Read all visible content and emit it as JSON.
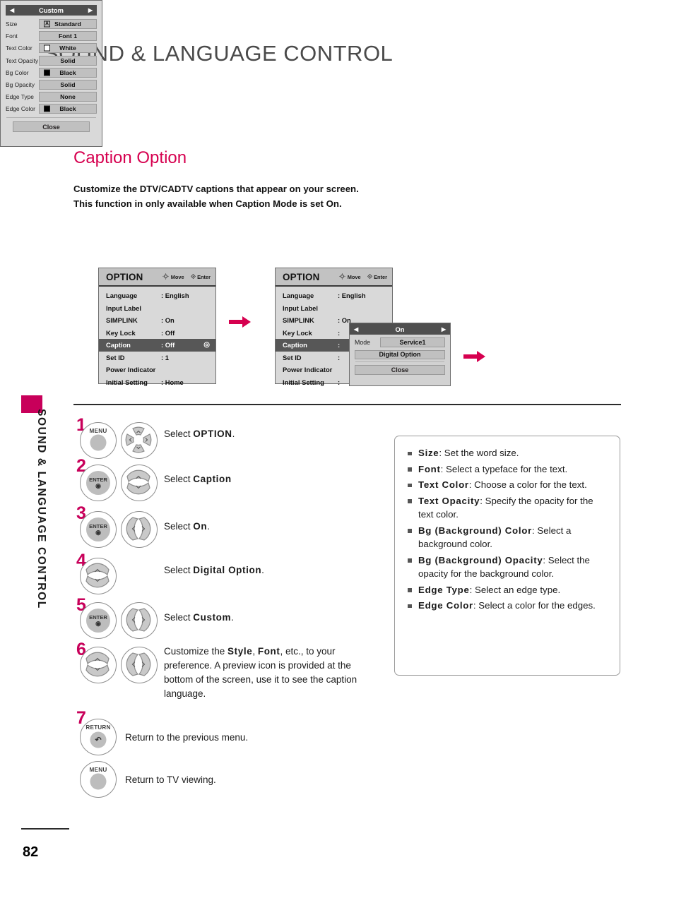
{
  "page": {
    "header_title": "SOUND & LANGUAGE CONTROL",
    "side_label": "SOUND & LANGUAGE CONTROL",
    "number": "82",
    "accent_color": "#c8005a"
  },
  "section": {
    "title": "Caption Option",
    "intro_line1": "Customize the DTV/CADTV captions that appear on your screen.",
    "intro_line2_a": "This function in only available when ",
    "intro_line2_b": "Caption",
    "intro_line2_c": " Mode is set ",
    "intro_line2_d": "On",
    "intro_line2_e": "."
  },
  "osd": {
    "menu1": {
      "title": "OPTION",
      "hint_move": "Move",
      "hint_enter": "Enter",
      "rows": [
        {
          "label": "Language",
          "value": ": English",
          "selected": false
        },
        {
          "label": "Input Label",
          "value": "",
          "selected": false
        },
        {
          "label": "SIMPLINK",
          "value": ": On",
          "selected": false
        },
        {
          "label": "Key Lock",
          "value": ": Off",
          "selected": false
        },
        {
          "label": "Caption",
          "value": ": Off",
          "selected": true
        },
        {
          "label": "Set ID",
          "value": ": 1",
          "selected": false
        },
        {
          "label": "Power Indicator",
          "value": "",
          "selected": false
        },
        {
          "label": "Initial Setting",
          "value": ": Home",
          "selected": false
        }
      ]
    },
    "menu2": {
      "title": "OPTION",
      "hint_move": "Move",
      "hint_enter": "Enter",
      "rows": [
        {
          "label": "Language",
          "value": ": English",
          "selected": false
        },
        {
          "label": "Input Label",
          "value": "",
          "selected": false
        },
        {
          "label": "SIMPLINK",
          "value": ": On",
          "selected": false
        },
        {
          "label": "Key Lock",
          "value": ":",
          "selected": false
        },
        {
          "label": "Caption",
          "value": ":",
          "selected": true
        },
        {
          "label": "Set ID",
          "value": ":",
          "selected": false
        },
        {
          "label": "Power Indicator",
          "value": "",
          "selected": false
        },
        {
          "label": "Initial Setting",
          "value": ":",
          "selected": false
        }
      ]
    },
    "popup": {
      "bar_title": "On",
      "left_arrow": "◀",
      "right_arrow": "▶",
      "mode_label": "Mode",
      "mode_value": "Service1",
      "digital_option": "Digital Option",
      "close": "Close"
    },
    "custom": {
      "bar_title": "Custom",
      "left_arrow": "◀",
      "right_arrow": "▶",
      "rows": [
        {
          "label": "Size",
          "value": "Standard",
          "swatch": "letter",
          "swatch_text": "A",
          "swatch_color": ""
        },
        {
          "label": "Font",
          "value": "Font 1",
          "swatch": "none",
          "swatch_text": "",
          "swatch_color": ""
        },
        {
          "label": "Text Color",
          "value": "White",
          "swatch": "color",
          "swatch_text": "",
          "swatch_color": "#ffffff"
        },
        {
          "label": "Text Opacity",
          "value": "Solid",
          "swatch": "none",
          "swatch_text": "",
          "swatch_color": ""
        },
        {
          "label": "Bg Color",
          "value": "Black",
          "swatch": "color",
          "swatch_text": "",
          "swatch_color": "#000000"
        },
        {
          "label": "Bg Opacity",
          "value": "Solid",
          "swatch": "none",
          "swatch_text": "",
          "swatch_color": ""
        },
        {
          "label": "Edge Type",
          "value": "None",
          "swatch": "none",
          "swatch_text": "",
          "swatch_color": ""
        },
        {
          "label": "Edge Color",
          "value": "Black",
          "swatch": "color",
          "swatch_text": "",
          "swatch_color": "#000000"
        }
      ],
      "close": "Close"
    }
  },
  "steps": [
    {
      "num": "1",
      "buttons": [
        "MENU",
        "nav4"
      ],
      "text_pre": "Select ",
      "text_bold": "OPTION",
      "text_post": "."
    },
    {
      "num": "2",
      "buttons": [
        "ENTER",
        "updown"
      ],
      "text_pre": "Select ",
      "text_bold": "Caption",
      "text_post": ""
    },
    {
      "num": "3",
      "buttons": [
        "ENTER",
        "leftright"
      ],
      "text_pre": "Select ",
      "text_bold": "On",
      "text_post": "."
    },
    {
      "num": "4",
      "buttons": [
        "updown"
      ],
      "text_pre": "Select ",
      "text_bold": "Digital Option",
      "text_post": "."
    },
    {
      "num": "5",
      "buttons": [
        "ENTER",
        "leftright"
      ],
      "text_pre": "Select ",
      "text_bold": "Custom",
      "text_post": "."
    },
    {
      "num": "6",
      "buttons": [
        "updown",
        "leftright"
      ],
      "text_pre": "Customize the ",
      "text_bold": "Style",
      "text_post": ""
    },
    {
      "num": "7",
      "buttons": [
        "RETURN"
      ],
      "text_pre": "Return to the previous menu.",
      "text_bold": "",
      "text_post": ""
    }
  ],
  "step6_text": {
    "b1": "Style",
    "b2": "Font",
    "pre": "Customize the ",
    "mid": ", ",
    "rest": ", etc., to your preference. A preview icon is provided at the bottom of the screen, use it to see the caption language."
  },
  "step_return": {
    "label": "RETURN",
    "text": "Return to the previous menu."
  },
  "step_menu": {
    "label": "MENU",
    "text": "Return to TV viewing."
  },
  "button_labels": {
    "menu": "MENU",
    "enter": "ENTER",
    "return": "RETURN"
  },
  "info_box": {
    "items": [
      {
        "term": "Size",
        "desc": ": Set the word size."
      },
      {
        "term": "Font",
        "desc": ": Select a typeface for the text."
      },
      {
        "term": "Text Color",
        "desc": ": Choose a color for the text."
      },
      {
        "term": "Text Opacity",
        "desc": ": Specify the opacity for the text color."
      },
      {
        "term": "Bg (Background) Color",
        "desc": ": Select a background color."
      },
      {
        "term": "Bg (Background) Opacity",
        "desc": ": Select the opacity for the background color."
      },
      {
        "term": "Edge Type",
        "desc": ": Select an edge type."
      },
      {
        "term": "Edge Color",
        "desc": ": Select a color for the edges."
      }
    ]
  }
}
